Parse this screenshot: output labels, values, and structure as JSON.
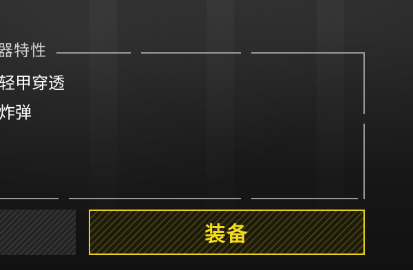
{
  "weapon_traits": {
    "title": "器特性",
    "items": [
      "轻甲穿透",
      "炸弹"
    ]
  },
  "actions": {
    "equip_label": "装备"
  },
  "colors": {
    "accent": "#e8d21a",
    "text": "#ffffff",
    "muted": "#cfcfcf"
  }
}
